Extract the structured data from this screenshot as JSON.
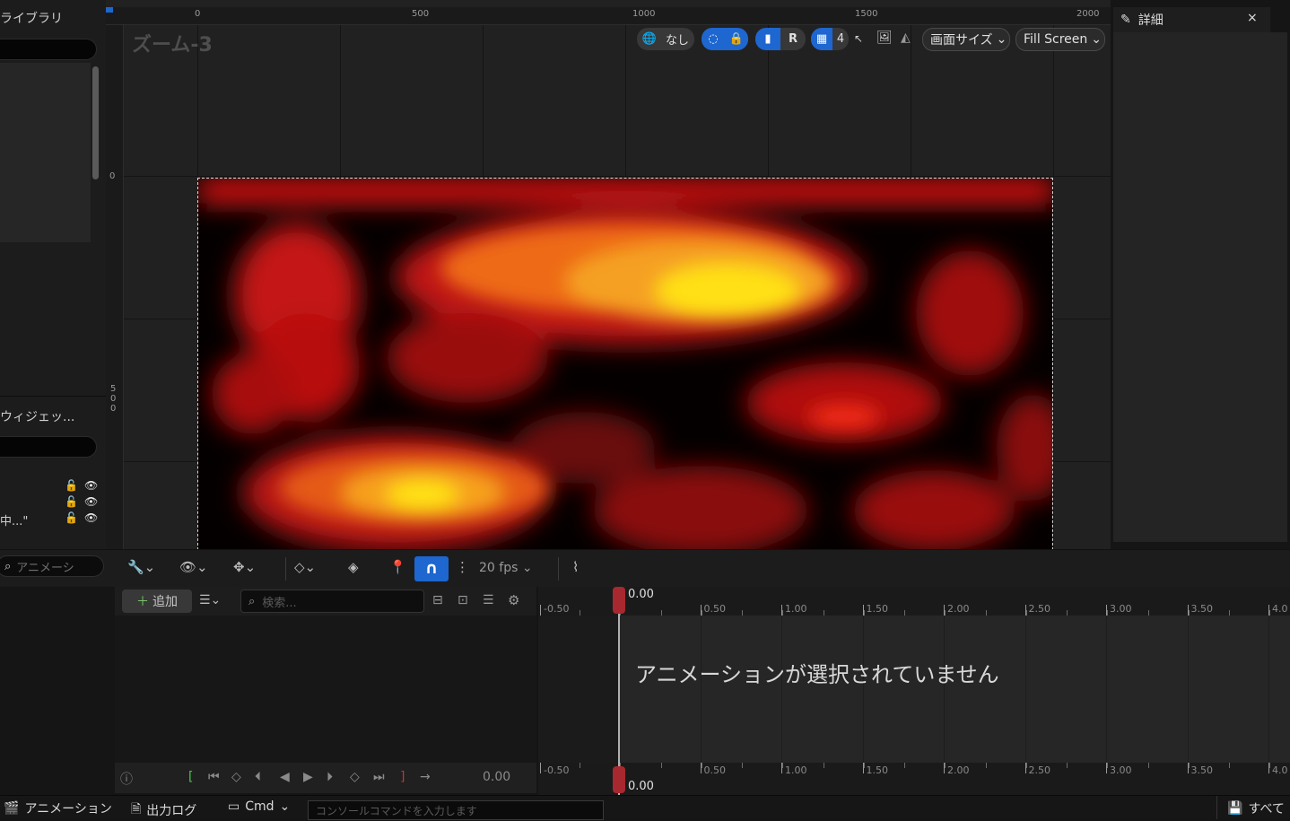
{
  "left_panel": {
    "library_title": "ライブラリ",
    "widget_title": "ウィジェッ...",
    "tree_item_label": "中...\""
  },
  "designer": {
    "zoom_label": "ズーム-3",
    "ruler_h_labels": [
      "0",
      "500",
      "1000",
      "1500",
      "2000"
    ],
    "ruler_v_labels": [
      "0",
      "5",
      "0",
      "0"
    ],
    "toolbar": {
      "world_label": "なし",
      "r_label": "R",
      "grid_value": "4",
      "screen_size_label": "画面サイズ",
      "fill_mode_label": "Fill Screen"
    }
  },
  "details_panel": {
    "title": "詳細",
    "close_label": "×"
  },
  "animation": {
    "search_placeholder": "アニメーシ",
    "fps_label": "20 fps",
    "add_label": "追加",
    "track_search_placeholder": "検索...",
    "current_time": "0.00",
    "empty_message": "アニメーションが選択されていません",
    "playhead_top_value": "0.00",
    "playhead_bottom_value": "0.00",
    "ruler_labels": [
      "-0.50",
      "0.50",
      "1.00",
      "1.50",
      "2.00",
      "2.50",
      "3.00",
      "3.50",
      "4.0"
    ]
  },
  "statusbar": {
    "animation_tab": "アニメーション",
    "output_log_tab": "出力ログ",
    "cmd_label": "Cmd",
    "console_placeholder": "コンソールコマンドを入力します",
    "right_label": "すべて"
  },
  "colors": {
    "accent_blue": "#1e66d0",
    "playhead_red": "#a8282f"
  }
}
